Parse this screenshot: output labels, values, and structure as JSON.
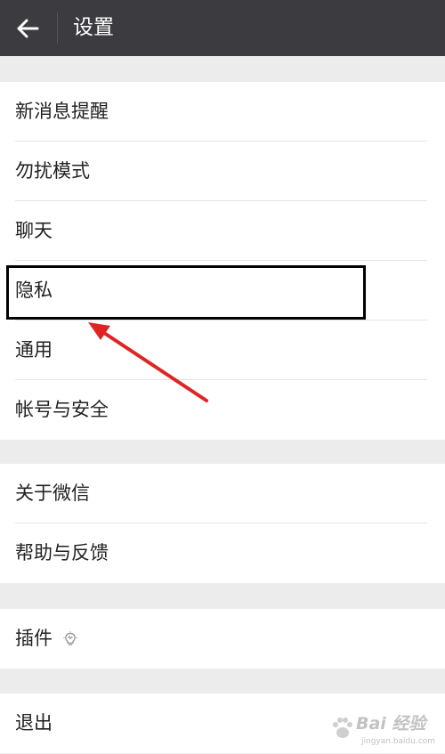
{
  "header": {
    "title": "设置",
    "back_icon": "arrow-left-icon"
  },
  "sections": [
    {
      "items": [
        {
          "label": "新消息提醒"
        },
        {
          "label": "勿扰模式"
        },
        {
          "label": "聊天"
        },
        {
          "label": "隐私"
        },
        {
          "label": "通用"
        },
        {
          "label": "帐号与安全"
        }
      ]
    },
    {
      "items": [
        {
          "label": "关于微信"
        },
        {
          "label": "帮助与反馈"
        }
      ]
    },
    {
      "items": [
        {
          "label": "插件",
          "icon": "lightbulb-icon"
        }
      ]
    },
    {
      "items": [
        {
          "label": "退出"
        }
      ]
    }
  ],
  "annotation": {
    "highlighted_item": "隐私",
    "box_color": "#000000",
    "arrow_color": "#e02424"
  },
  "watermark": {
    "text": "Bai 经验",
    "subtext": "jingyan.baidu.com"
  },
  "colors": {
    "header_bg": "#3b3b40",
    "page_bg": "#ececec",
    "row_bg": "#ffffff",
    "text": "#222222"
  }
}
